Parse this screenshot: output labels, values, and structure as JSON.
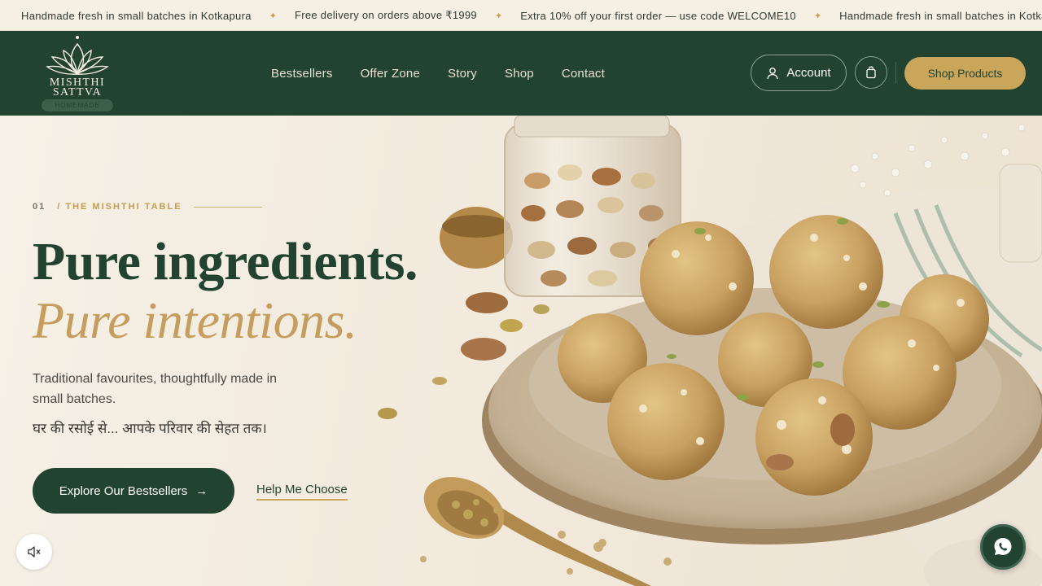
{
  "announcement": {
    "items": [
      "Handmade fresh in small batches in Kotkapura",
      "Free delivery on orders above ₹1999",
      "Extra 10% off your first order — use code WELCOME10",
      "Handmade fresh in small batches in Kotkapura"
    ],
    "separator": "✦"
  },
  "header": {
    "logo": {
      "line1": "MISHTHI",
      "line2": "SATTVA",
      "badge": "HOMEMADE"
    },
    "nav": [
      "Bestsellers",
      "Offer Zone",
      "Story",
      "Shop",
      "Contact"
    ],
    "account_label": "Account",
    "cart_icon": "shopping-bag-icon",
    "shop_label": "Shop Products"
  },
  "hero": {
    "kicker_num": "01",
    "kicker_label": "/ THE MISHTHI TABLE",
    "title_line1": "Pure ingredients.",
    "title_line2": "Pure intentions.",
    "subtitle": "Traditional favourites, thoughtfully made in small batches.",
    "hindi_line": "घर की रसोई से... आपके परिवार की सेहत तक।",
    "primary_cta": "Explore Our Bestsellers",
    "primary_cta_arrow": "→",
    "secondary_cta": "Help Me Choose"
  },
  "floating": {
    "mute_icon": "speaker-muted-icon",
    "whatsapp_icon": "whatsapp-icon"
  },
  "colors": {
    "brand_green": "#22432f",
    "gold": "#c9a65a",
    "cream": "#f3ece1"
  }
}
